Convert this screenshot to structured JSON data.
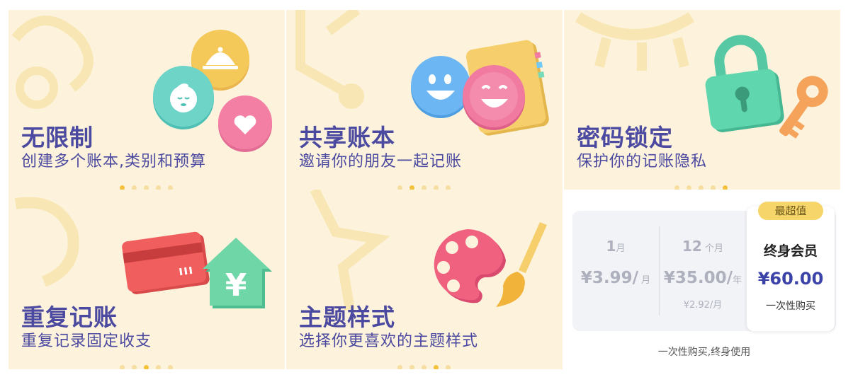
{
  "features": [
    {
      "title": "无限制",
      "subtitle": "创建多个账本,类别和预算",
      "active_dot": 0
    },
    {
      "title": "共享账本",
      "subtitle": "邀请你的朋友一起记账",
      "active_dot": 1
    },
    {
      "title": "密码锁定",
      "subtitle": "保护你的记账隐私",
      "active_dot": 4
    },
    {
      "title": "重复记账",
      "subtitle": "重复记录固定收支",
      "active_dot": 2
    },
    {
      "title": "主题样式",
      "subtitle": "选择你更喜欢的主题样式",
      "active_dot": 3
    }
  ],
  "pricing": {
    "plans": [
      {
        "name_num": "1",
        "name_unit": "月",
        "price": "¥3.99/",
        "price_unit": "月",
        "note": ""
      },
      {
        "name_num": "12",
        "name_unit": "个月",
        "price": "¥35.00/",
        "price_unit": "年",
        "note": "¥2.92/月"
      }
    ],
    "best": {
      "badge": "最超值",
      "name": "终身会员",
      "price": "¥60.00",
      "note": "一次性购买"
    },
    "footnote": "一次性购买,终身使用"
  },
  "colors": {
    "panel_bg": "#fdf3dc",
    "title": "#4b4aa0",
    "dot_active": "#f3c13a",
    "best_price": "#3c43a8",
    "badge": "#f6d66a"
  },
  "icons": [
    "food-cover-icon",
    "baby-face-icon",
    "heart-icon",
    "smiley-face-icon",
    "notebook-icon",
    "padlock-icon",
    "key-icon",
    "credit-card-icon",
    "yuan-house-icon",
    "palette-icon",
    "paintbrush-icon"
  ]
}
